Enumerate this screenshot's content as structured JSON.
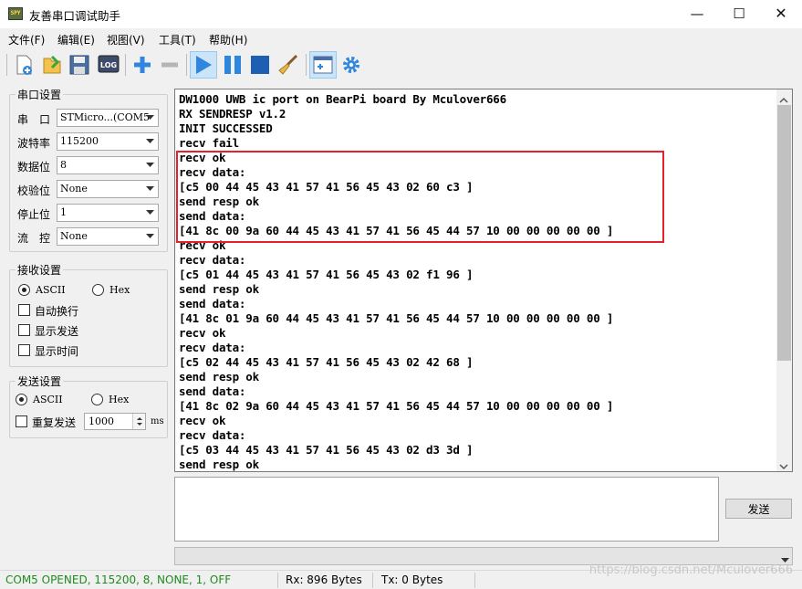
{
  "window": {
    "app_icon_text": "SPY",
    "title": "友善串口调试助手",
    "minimize": "—",
    "maximize": "☐",
    "close": "✕"
  },
  "menu": [
    "文件(F)",
    "编辑(E)",
    "视图(V)",
    "工具(T)",
    "帮助(H)"
  ],
  "toolbar": {
    "log_label": "LOG",
    "colors": {
      "blue": "#2e86de",
      "dark_blue": "#1e5fb4",
      "active_bg": "#cce4f7"
    }
  },
  "serial_settings": {
    "title": "串口设置",
    "rows": [
      {
        "label": "串　口",
        "value": "STMicro...(COM5"
      },
      {
        "label": "波特率",
        "value": "115200"
      },
      {
        "label": "数据位",
        "value": "8"
      },
      {
        "label": "校验位",
        "value": "None"
      },
      {
        "label": "停止位",
        "value": "1"
      },
      {
        "label": "流　控",
        "value": "None"
      }
    ]
  },
  "receive_settings": {
    "title": "接收设置",
    "ascii": "ASCII",
    "hex": "Hex",
    "selected": "ASCII",
    "auto_wrap": "自动换行",
    "show_send": "显示发送",
    "show_time": "显示时间"
  },
  "send_settings": {
    "title": "发送设置",
    "ascii": "ASCII",
    "hex": "Hex",
    "selected": "ASCII",
    "repeat": "重复发送",
    "interval": "1000",
    "unit": "ms"
  },
  "receive_lines": [
    "DW1000 UWB ic port on BearPi board By Mculover666",
    "RX SENDRESP v1.2",
    "INIT SUCCESSED",
    "recv fail",
    "recv ok",
    "recv data:",
    "[c5 00 44 45 43 41 57 41 56 45 43 02 60 c3 ]",
    "send resp ok",
    "send data:",
    "[41 8c 00 9a 60 44 45 43 41 57 41 56 45 44 57 10 00 00 00 00 00 ]",
    "recv ok",
    "recv data:",
    "[c5 01 44 45 43 41 57 41 56 45 43 02 f1 96 ]",
    "send resp ok",
    "send data:",
    "[41 8c 01 9a 60 44 45 43 41 57 41 56 45 44 57 10 00 00 00 00 00 ]",
    "recv ok",
    "recv data:",
    "[c5 02 44 45 43 41 57 41 56 45 43 02 42 68 ]",
    "send resp ok",
    "send data:",
    "[41 8c 02 9a 60 44 45 43 41 57 41 56 45 44 57 10 00 00 00 00 00 ]",
    "recv ok",
    "recv data:",
    "[c5 03 44 45 43 41 57 41 56 45 43 02 d3 3d ]",
    "send resp ok"
  ],
  "send_button": "发送",
  "status": {
    "port": "COM5 OPENED, 115200, 8, NONE, 1, OFF",
    "port_color": "#1e8b1e",
    "rx": "Rx: 896 Bytes",
    "tx": "Tx: 0 Bytes"
  },
  "watermark": "https://blog.csdn.net/Mculover666",
  "highlight_color": "#e8202a"
}
